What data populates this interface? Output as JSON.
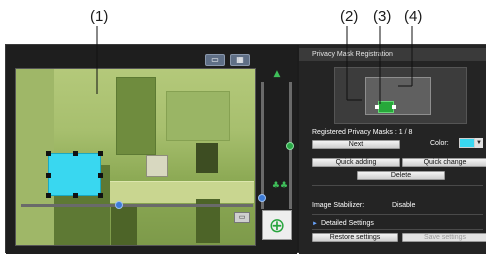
{
  "callouts": [
    "(1)",
    "(2)",
    "(3)",
    "(4)"
  ],
  "viewer": {
    "toolbar_icons": [
      "frame-icon",
      "grid-icon"
    ],
    "pan_slider_value": 0.42,
    "zoom_slider_value": 0.06,
    "focus_slider_value": 0.5
  },
  "panel": {
    "title": "Privacy Mask Registration",
    "registered_masks": "Registered Privacy Masks : 1 / 8",
    "next_button": "Next",
    "color_label": "Color:",
    "mask_color": "#39d7f0",
    "quick_adding_button": "Quick adding",
    "quick_change_button": "Quick change",
    "delete_button": "Delete",
    "image_stabilizer_label": "Image Stabilizer:",
    "image_stabilizer_value": "Disable",
    "detailed_settings": "Detailed Settings",
    "restore_button": "Restore settings",
    "save_button": "Save settings"
  },
  "colors": {
    "mask": "#39d7f0",
    "preview_mask": "#27a83a",
    "accent_blue": "#3d7bd6",
    "accent_green": "#28a745"
  }
}
